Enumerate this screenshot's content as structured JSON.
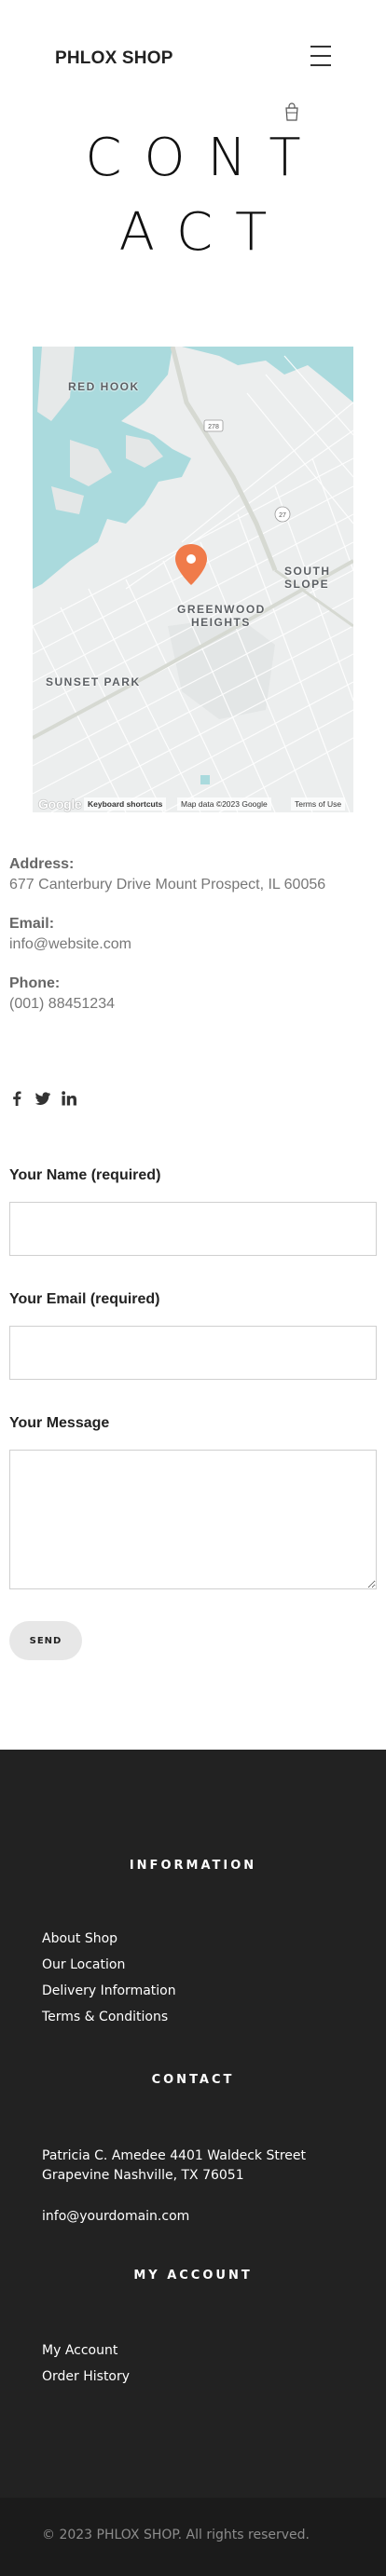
{
  "header": {
    "logo": "PHLOX SHOP",
    "menu_icon": "hamburger-icon",
    "cart_icon": "shopping-bag-icon"
  },
  "page_title": "CONTACT",
  "map": {
    "labels": {
      "red_hook": "RED HOOK",
      "south_slope": "SOUTH SLOPE",
      "greenwood_1": "GREENWOOD",
      "greenwood_2": "HEIGHTS",
      "sunset_park": "SUNSET PARK"
    },
    "route_shields": [
      "278",
      "27"
    ],
    "marker_color": "#f07b4a",
    "google_logo": "Google",
    "keyboard_shortcuts": "Keyboard shortcuts",
    "map_data": "Map data ©2023 Google",
    "terms": "Terms of Use"
  },
  "contact": {
    "address_label": "Address:",
    "address_value": "677 Canterbury Drive Mount Prospect, IL 60056",
    "email_label": "Email:",
    "email_value": "info@website.com",
    "phone_label": "Phone:",
    "phone_value": "(001) 88451234"
  },
  "socials": [
    "facebook-icon",
    "twitter-icon",
    "linkedin-icon"
  ],
  "form": {
    "name_label": "Your Name (required)",
    "name_value": "",
    "email_label": "Your Email (required)",
    "email_value": "",
    "message_label": "Your Message",
    "message_value": "",
    "send_label": "SEND"
  },
  "footer": {
    "information": {
      "heading": "INFORMATION",
      "links": [
        "About Shop",
        "Our Location",
        "Delivery Information",
        "Terms & Conditions"
      ]
    },
    "contact": {
      "heading": "CONTACT",
      "address_line1": "Patricia C. Amedee 4401 Waldeck Street",
      "address_line2": "Grapevine Nashville, TX 76051",
      "email": "info@yourdomain.com"
    },
    "account": {
      "heading": "MY ACCOUNT",
      "links": [
        "My Account",
        "Order History"
      ]
    },
    "copyright": "© 2023 PHLOX SHOP. All rights reserved."
  },
  "colors": {
    "footer_bg": "#222222",
    "footer_bottom_bg": "#1b1b1b",
    "water": "#aadadd",
    "map_marker": "#f07b4a"
  }
}
